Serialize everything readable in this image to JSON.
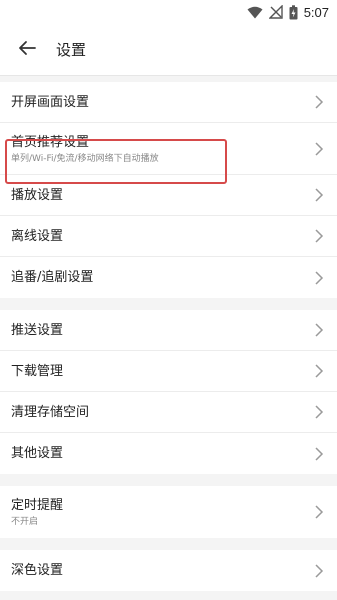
{
  "status_bar": {
    "time": "5:07"
  },
  "app_bar": {
    "title": "设置"
  },
  "groups": [
    {
      "items": [
        {
          "label": "开屏画面设置"
        },
        {
          "label": "首页推荐设置",
          "sub": "单列/Wi-Fi/免流/移动网络下自动播放"
        },
        {
          "label": "播放设置"
        },
        {
          "label": "离线设置"
        },
        {
          "label": "追番/追剧设置"
        }
      ]
    },
    {
      "items": [
        {
          "label": "推送设置"
        },
        {
          "label": "下载管理"
        },
        {
          "label": "清理存储空间"
        },
        {
          "label": "其他设置"
        }
      ]
    },
    {
      "items": [
        {
          "label": "定时提醒",
          "sub": "不开启"
        }
      ]
    },
    {
      "items": [
        {
          "label": "深色设置"
        }
      ]
    }
  ],
  "colors": {
    "highlight": "#d64a4a",
    "chevron": "#9a9a9a"
  },
  "icons": {
    "back": "arrow-left-icon",
    "row": "chevron-right-icon"
  }
}
